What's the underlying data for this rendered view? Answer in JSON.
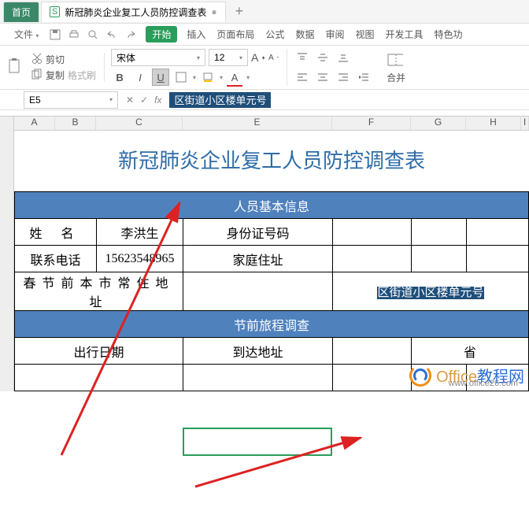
{
  "tabs": {
    "home": "首页",
    "doc_icon": "S",
    "doc": "新冠肺炎企业复工人员防控调查表",
    "dirty": "●",
    "add": "+"
  },
  "menu": {
    "file": "文件",
    "caret": "▾",
    "start": "开始",
    "insert": "插入",
    "layout": "页面布局",
    "formula": "公式",
    "data": "数据",
    "review": "审阅",
    "view": "视图",
    "dev": "开发工具",
    "special": "特色功"
  },
  "toolbar": {
    "cut": "剪切",
    "copy": "复制",
    "fmtbrush": "格式刷",
    "font": "宋体",
    "size": "12",
    "bold": "B",
    "italic": "I",
    "underline": "U",
    "AplusBig": "A",
    "AplusSmall": "A",
    "fontcolor": "A",
    "caret": "▾"
  },
  "fx": {
    "cellref": "E5",
    "caret": "▾",
    "x": "✕",
    "check": "✓",
    "fx": "fx",
    "value": "区街道小区楼单元号"
  },
  "cols": {
    "A": "A",
    "B": "B",
    "C": "C",
    "E": "E",
    "F": "F",
    "G": "G",
    "H": "H",
    "I": "I"
  },
  "sheet": {
    "title": "新冠肺炎企业复工人员防控调查表",
    "group1": "人员基本信息",
    "r3a": "姓    名",
    "r3b": "李洪生",
    "r3c": "身份证号码",
    "r4a": "联系电话",
    "r4b": "15623548965",
    "r4c": "家庭住址",
    "r5a": "春节前本市常住地址",
    "r5b": "区街道小区楼单元号",
    "group2": "节前旅程调查",
    "r7a": "出行日期",
    "r7b": "到达地址",
    "r7c": "省"
  },
  "watermark": {
    "t1": "Office",
    "t2": "教程网",
    "sub": "www.office26.com"
  }
}
